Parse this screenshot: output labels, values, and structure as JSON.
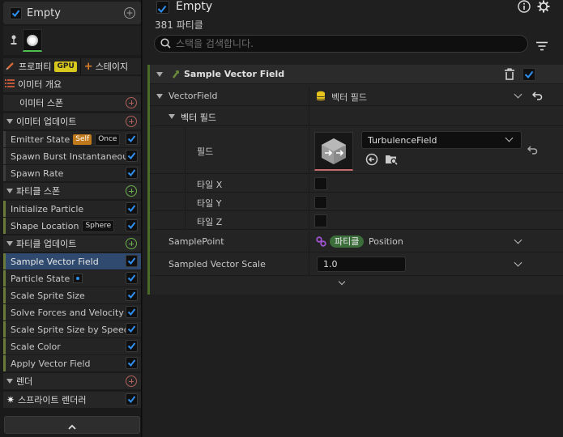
{
  "emitter": {
    "title": "Empty"
  },
  "tabs": {
    "properties": "프로퍼티",
    "gpu": "GPU",
    "stage": "스테이지"
  },
  "left_items": [
    {
      "label": "이미터 개요"
    },
    {
      "label": "이미터 스폰"
    },
    {
      "label": "이미터 업데이트"
    },
    {
      "label": "Emitter State",
      "badge1": "Self",
      "badge2": "Once"
    },
    {
      "label": "Spawn Burst Instantaneous"
    },
    {
      "label": "Spawn Rate"
    },
    {
      "label": "파티클 스폰"
    },
    {
      "label": "Initialize Particle"
    },
    {
      "label": "Shape Location",
      "badge1": "Sphere"
    },
    {
      "label": "파티클 업데이트"
    },
    {
      "label": "Sample Vector Field"
    },
    {
      "label": "Particle State"
    },
    {
      "label": "Scale Sprite Size"
    },
    {
      "label": "Solve Forces and Velocity"
    },
    {
      "label": "Scale Sprite Size by Speed"
    },
    {
      "label": "Scale Color"
    },
    {
      "label": "Apply Vector Field"
    },
    {
      "label": "렌더"
    },
    {
      "label": "스프라이트 렌더러"
    }
  ],
  "header": {
    "title": "Empty",
    "count": "381 파티클"
  },
  "search": {
    "placeholder": "스택을 검색합니다."
  },
  "module": {
    "title": "Sample Vector Field",
    "vector_field_label": "VectorField",
    "vector_field_value": "벡터 필드",
    "sub_section": "벡터 필드",
    "field_label": "필드",
    "field_asset": "TurbulenceField",
    "tile_x": "타일 X",
    "tile_y": "타일 Y",
    "tile_z": "타일 Z",
    "sample_point_label": "SamplePoint",
    "sample_point_pill": "파티클",
    "sample_point_value": "Position",
    "scale_label": "Sampled Vector Scale",
    "scale_value": "1.0"
  },
  "colors": {
    "accent": "#2f6fd6",
    "selected_row": "#2f4a6e",
    "section_green": "#4a6a2a"
  }
}
